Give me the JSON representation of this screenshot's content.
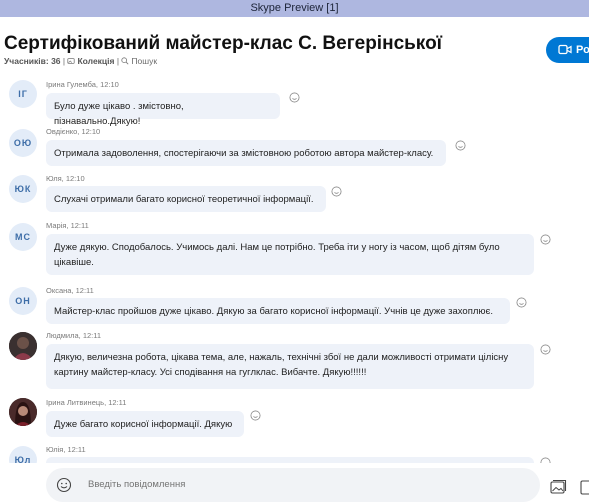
{
  "window": {
    "title": "Skype Preview [1]"
  },
  "conversation": {
    "title": "Сертифікований майстер-клас С. Вегерінської",
    "participants": "Учасників: 36",
    "collection": "Колекція",
    "search": "Пошук",
    "call_button": "Ро"
  },
  "messages": [
    {
      "avatar": "ІГ",
      "sender": "Ірина Гулемба, 12:10",
      "lines": [
        "Було дуже цікаво . змістовно, пізнавально.Дякую!"
      ]
    },
    {
      "avatar": "ОЮ",
      "sender": "Овдієнко, 12:10",
      "lines": [
        "Отримала задоволення, спостерігаючи за змістовною роботою автора майстер-класу."
      ]
    },
    {
      "avatar": "ЮК",
      "sender": "Юля, 12:10",
      "lines": [
        "Слухачі отримали багато корисної теоретичної інформації."
      ]
    },
    {
      "avatar": "МС",
      "sender": "Марія, 12:11",
      "lines": [
        "Дуже дякую. Сподобалось. Учимось далі. Нам це потрібно. Треба іти у ногу із часом, щоб дітям було",
        "цікавіше."
      ]
    },
    {
      "avatar": "ОН",
      "sender": "Оксана, 12:11",
      "lines": [
        "Майстер-клас пройшов дуже цікаво. Дякую за багато корисної інформації. Учнів це дуже захоплює."
      ]
    },
    {
      "avatar": "",
      "sender": "Людмила, 12:11",
      "lines": [
        "Дякую,  величезна робота, цікава тема, але, нажаль, технічні збої не дали можливості отримати цілісну",
        "картину майстер-класу. Усі сподівання на гуглклас. Вибачте. Дякую!!!!!!"
      ]
    },
    {
      "avatar": "",
      "sender": "Ірина Литвинець, 12:11",
      "lines": [
        "Дуже багато корисної інформації. Дякую"
      ]
    },
    {
      "avatar": "Юл",
      "sender": "Юлія, 12:11",
      "lines": [
        ""
      ]
    }
  ],
  "composer": {
    "placeholder": "Введіть повідомлення"
  }
}
